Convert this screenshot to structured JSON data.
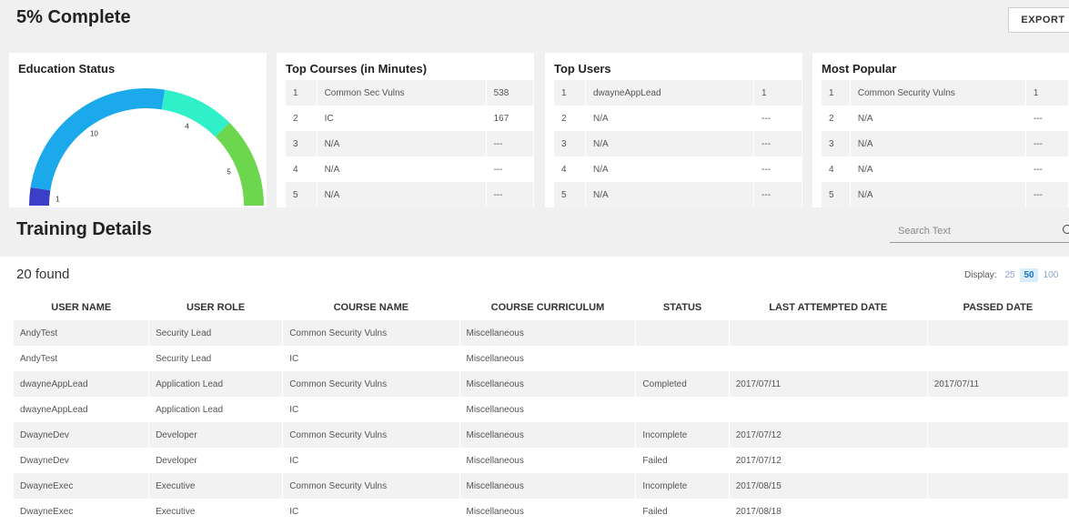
{
  "header": {
    "title": "5% Complete",
    "export_label": "EXPORT"
  },
  "education_status": {
    "title": "Education Status",
    "gauge_segments": [
      {
        "label": "1",
        "value": 1,
        "color": "#3b3fc8"
      },
      {
        "label": "10",
        "value": 10,
        "color": "#1ca9ec"
      },
      {
        "label": "4",
        "value": 4,
        "color": "#2ff0c8"
      },
      {
        "label": "5",
        "value": 5,
        "color": "#6dd64f"
      }
    ]
  },
  "top_courses": {
    "title": "Top Courses (in Minutes)",
    "rows": [
      {
        "rank": "1",
        "name": "Common Sec Vulns",
        "value": "538"
      },
      {
        "rank": "2",
        "name": "IC",
        "value": "167"
      },
      {
        "rank": "3",
        "name": "N/A",
        "value": "---"
      },
      {
        "rank": "4",
        "name": "N/A",
        "value": "---"
      },
      {
        "rank": "5",
        "name": "N/A",
        "value": "---"
      }
    ]
  },
  "top_users": {
    "title": "Top Users",
    "rows": [
      {
        "rank": "1",
        "name": "dwayneAppLead",
        "value": "1"
      },
      {
        "rank": "2",
        "name": "N/A",
        "value": "---"
      },
      {
        "rank": "3",
        "name": "N/A",
        "value": "---"
      },
      {
        "rank": "4",
        "name": "N/A",
        "value": "---"
      },
      {
        "rank": "5",
        "name": "N/A",
        "value": "---"
      }
    ]
  },
  "most_popular": {
    "title": "Most Popular",
    "rows": [
      {
        "rank": "1",
        "name": "Common Security Vulns",
        "value": "1"
      },
      {
        "rank": "2",
        "name": "N/A",
        "value": "---"
      },
      {
        "rank": "3",
        "name": "N/A",
        "value": "---"
      },
      {
        "rank": "4",
        "name": "N/A",
        "value": "---"
      },
      {
        "rank": "5",
        "name": "N/A",
        "value": "---"
      }
    ]
  },
  "training": {
    "title": "Training Details",
    "search_placeholder": "Search Text",
    "found_text": "20 found",
    "display_label": "Display:",
    "display_options": [
      "25",
      "50",
      "100"
    ],
    "display_selected": "50",
    "columns": [
      "USER NAME",
      "USER ROLE",
      "COURSE NAME",
      "COURSE CURRICULUM",
      "STATUS",
      "LAST ATTEMPTED DATE",
      "PASSED DATE"
    ],
    "rows": [
      [
        "AndyTest",
        "Security Lead",
        "Common Security Vulns",
        "Miscellaneous",
        "",
        "",
        ""
      ],
      [
        "AndyTest",
        "Security Lead",
        "IC",
        "Miscellaneous",
        "",
        "",
        ""
      ],
      [
        "dwayneAppLead",
        "Application Lead",
        "Common Security Vulns",
        "Miscellaneous",
        "Completed",
        "2017/07/11",
        "2017/07/11"
      ],
      [
        "dwayneAppLead",
        "Application Lead",
        "IC",
        "Miscellaneous",
        "",
        "",
        ""
      ],
      [
        "DwayneDev",
        "Developer",
        "Common Security Vulns",
        "Miscellaneous",
        "Incomplete",
        "2017/07/12",
        ""
      ],
      [
        "DwayneDev",
        "Developer",
        "IC",
        "Miscellaneous",
        "Failed",
        "2017/07/12",
        ""
      ],
      [
        "DwayneExec",
        "Executive",
        "Common Security Vulns",
        "Miscellaneous",
        "Incomplete",
        "2017/08/15",
        ""
      ],
      [
        "DwayneExec",
        "Executive",
        "IC",
        "Miscellaneous",
        "Failed",
        "2017/08/18",
        ""
      ]
    ]
  }
}
